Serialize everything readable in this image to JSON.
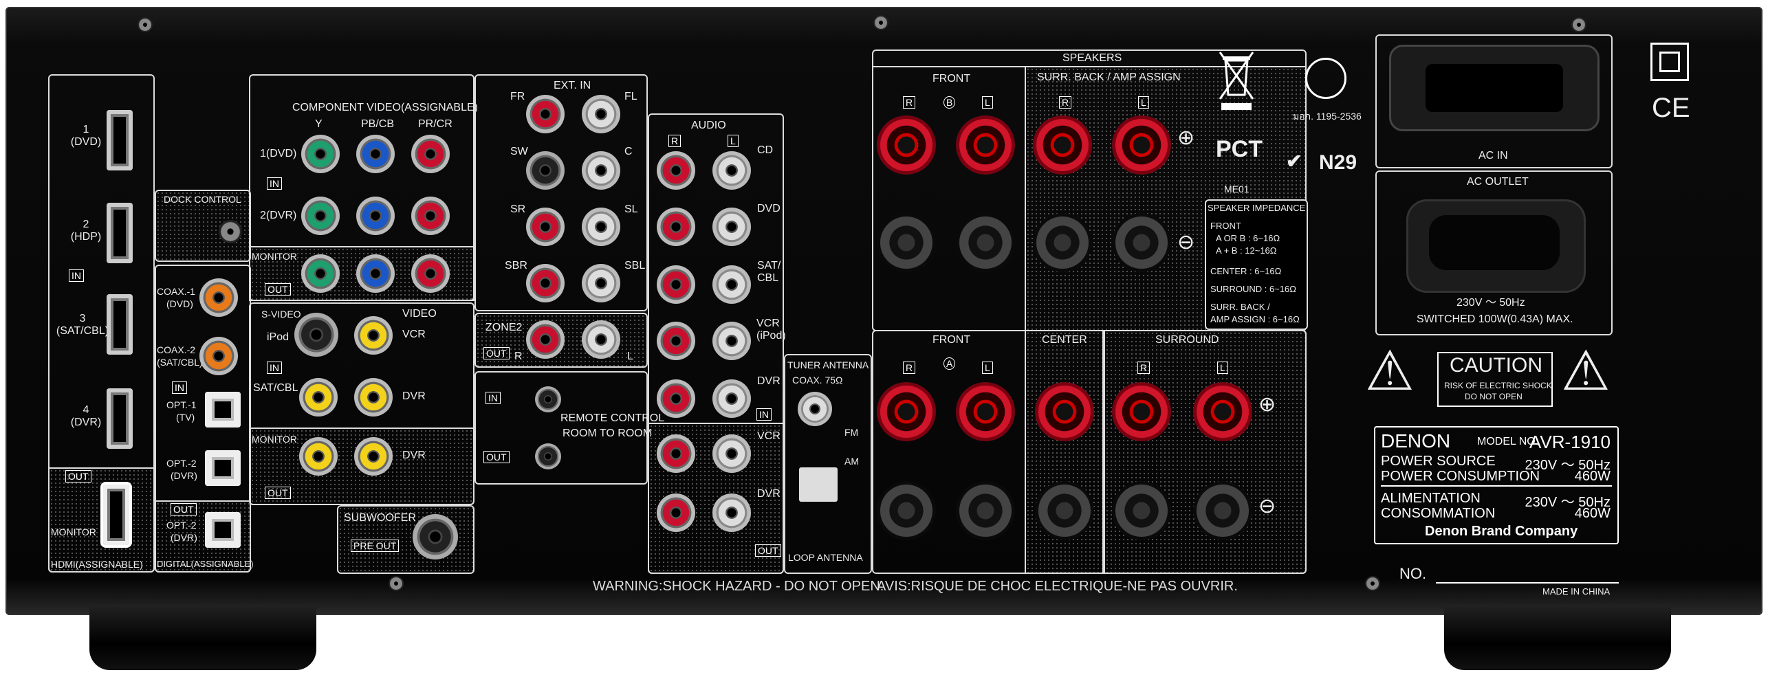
{
  "hdmi": {
    "inputs": [
      {
        "num": "1",
        "name": "(DVD)"
      },
      {
        "num": "2",
        "name": "(HDP)"
      },
      {
        "num": "3",
        "name": "(SAT/CBL)"
      },
      {
        "num": "4",
        "name": "(DVR)"
      }
    ],
    "in": "IN",
    "out": "OUT",
    "monitor": "MONITOR",
    "footer": "HDMI(ASSIGNABLE)"
  },
  "dock_control": "DOCK CONTROL",
  "digital": {
    "coax1": "COAX.-1",
    "coax1_name": "(DVD)",
    "coax2": "COAX.-2",
    "coax2_name": "(SAT/CBL)",
    "in": "IN",
    "opt1": "OPT.-1",
    "opt1_name": "(TV)",
    "opt2": "OPT.-2",
    "opt2_name": "(DVR)",
    "out": "OUT",
    "opt_out": "OPT.-2",
    "opt_out_name": "(DVR)",
    "footer": "DIGITAL(ASSIGNABLE)"
  },
  "component": {
    "title": "COMPONENT VIDEO(ASSIGNABLE)",
    "y": "Y",
    "pb": "PB/CB",
    "pr": "PR/CR",
    "row1": "1(DVD)",
    "row2": "2(DVR)",
    "in": "IN",
    "monitor": "MONITOR",
    "out": "OUT"
  },
  "video": {
    "svideo": "S-VIDEO",
    "video": "VIDEO",
    "ipod": "iPod",
    "vcr": "VCR",
    "in": "IN",
    "satcbl": "SAT/CBL",
    "dvr": "DVR",
    "monitor": "MONITOR",
    "dvr_out": "DVR",
    "out": "OUT"
  },
  "subwoofer": {
    "label": "SUBWOOFER",
    "pre_out": "PRE OUT"
  },
  "ext_in": {
    "title": "EXT. IN",
    "fr": "FR",
    "fl": "FL",
    "sw": "SW",
    "c": "C",
    "sr": "SR",
    "sl": "SL",
    "sbr": "SBR",
    "sbl": "SBL"
  },
  "zone2": {
    "label": "ZONE2",
    "out": "OUT",
    "r": "R",
    "l": "L"
  },
  "remote": {
    "in": "IN",
    "out": "OUT",
    "label1": "REMOTE CONTROL",
    "label2": "ROOM TO ROOM"
  },
  "audio": {
    "title": "AUDIO",
    "r": "R",
    "l": "L",
    "cd": "CD",
    "dvd": "DVD",
    "sat": "SAT/",
    "cbl": "CBL",
    "vcr": "VCR",
    "ipod": "(iPod)",
    "dvr": "DVR",
    "in": "IN",
    "vcr_out": "VCR",
    "dvr_out": "DVR",
    "out": "OUT"
  },
  "tuner": {
    "title": "TUNER ANTENNA",
    "coax": "COAX. 75Ω",
    "fm": "FM",
    "am": "AM",
    "loop": "LOOP ANTENNA"
  },
  "speakers": {
    "title": "SPEAKERS",
    "front": "FRONT",
    "surr_back": "SURR. BACK / AMP ASSIGN",
    "r": "R",
    "l": "L",
    "b": "B",
    "a": "A",
    "front2": "FRONT",
    "center": "CENTER",
    "surround": "SURROUND"
  },
  "impedance": {
    "title": "SPEAKER IMPEDANCE",
    "front": "FRONT",
    "a_or_b": "A OR B : 6~16Ω",
    "a_plus_b": "A + B : 12~16Ω",
    "center": "CENTER      : 6~16Ω",
    "surround": "SURROUND   : 6~16Ω",
    "surr_back": "SURR. BACK /",
    "amp_assign": "AMP ASSIGN : 6~16Ω"
  },
  "certs": {
    "thai": "มอก. 1195-2536",
    "me01": "ME01",
    "n29": "N29",
    "ce": "CE"
  },
  "ac": {
    "in": "AC IN",
    "outlet": "AC OUTLET",
    "rating1": "230V ～ 50Hz",
    "rating2": "SWITCHED 100W(0.43A) MAX."
  },
  "caution": {
    "title": "CAUTION",
    "line1": "RISK OF ELECTRIC SHOCK",
    "line2": "DO NOT OPEN"
  },
  "plate": {
    "brand": "DENON",
    "model_label": "MODEL NO.",
    "model": "AVR-1910",
    "power_source": "POWER SOURCE",
    "ps_val": "230V ～ 50Hz",
    "power_consumption": "POWER CONSUMPTION",
    "pc_val": "460W",
    "alimentation": "ALIMENTATION",
    "al_val": "230V ～ 50Hz",
    "consommation": "CONSOMMATION",
    "co_val": "460W",
    "company": "Denon Brand Company"
  },
  "warning_en": "WARNING:SHOCK HAZARD - DO NOT OPEN.",
  "warning_fr": "AVIS:RISQUE DE CHOC ELECTRIQUE-NE PAS OUVRIR.",
  "serial_label": "NO.",
  "made_in": "MADE IN CHINA"
}
